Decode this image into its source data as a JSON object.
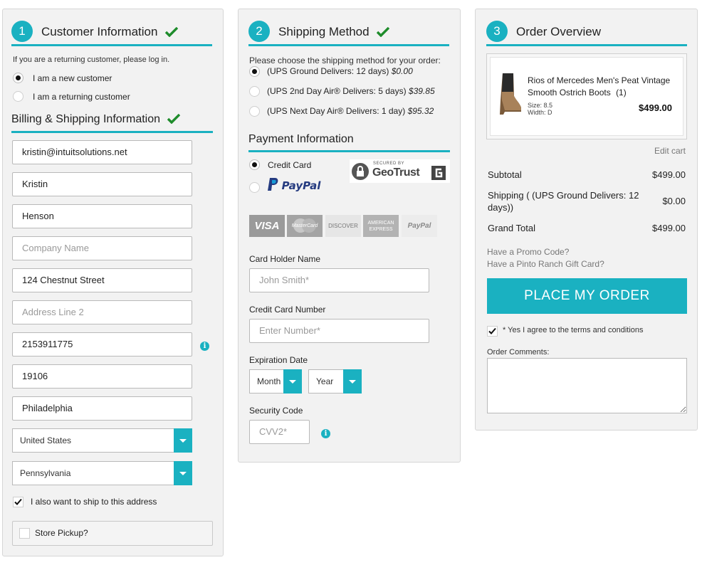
{
  "customer": {
    "step": "1",
    "title": "Customer Information",
    "returning_prompt": "If you are a returning customer, please log in.",
    "options": [
      "I am a new customer",
      "I am a returning customer"
    ],
    "billing_title": "Billing & Shipping Information",
    "fields": {
      "email": "kristin@intuitsolutions.net",
      "first_name": "Kristin",
      "last_name": "Henson",
      "company_placeholder": "Company Name",
      "address1": "124 Chestnut Street",
      "address2_placeholder": "Address Line 2",
      "phone": "2153911775",
      "zip": "19106",
      "city": "Philadelphia",
      "country": "United States",
      "state": "Pennsylvania"
    },
    "ship_to_label": "I also want to ship to this address",
    "store_pickup_label": "Store Pickup?"
  },
  "shipping": {
    "step": "2",
    "title": "Shipping Method",
    "prompt": "Please choose the shipping method for your order:",
    "methods": [
      {
        "label": "(UPS Ground Delivers: 12 days)",
        "price": "$0.00"
      },
      {
        "label": "(UPS 2nd Day Air® Delivers: 5 days)",
        "price": "$39.85"
      },
      {
        "label": "(UPS Next Day Air® Delivers: 1 day)",
        "price": "$95.32"
      }
    ]
  },
  "payment": {
    "title": "Payment Information",
    "credit_card_label": "Credit Card",
    "paypal_label": "PayPal",
    "geotrust_top": "SECURED BY",
    "geotrust_name": "GeoTrust",
    "card_logos": [
      "VISA",
      "MasterCard",
      "DISCOVER",
      "AMERICAN EXPRESS",
      "PayPal"
    ],
    "card_holder_label": "Card Holder Name",
    "card_holder_placeholder": "John Smith*",
    "card_number_label": "Credit Card Number",
    "card_number_placeholder": "Enter Number*",
    "expiration_label": "Expiration Date",
    "month": "Month",
    "year": "Year",
    "security_label": "Security Code",
    "security_placeholder": "CVV2*"
  },
  "overview": {
    "step": "3",
    "title": "Order Overview",
    "product": {
      "name": "Rios of Mercedes Men's Peat Vintage Smooth Ostrich Boots",
      "qty": "(1)",
      "size": "Size: 8.5",
      "width": "Width: D",
      "price": "$499.00"
    },
    "edit_cart": "Edit cart",
    "subtotal_label": "Subtotal",
    "subtotal": "$499.00",
    "shipping_label": "Shipping ( (UPS Ground Delivers: 12 days))",
    "shipping": "$0.00",
    "grand_total_label": "Grand Total",
    "grand_total": "$499.00",
    "promo_link": "Have a Promo Code?",
    "gift_card_link": "Have a Pinto Ranch Gift Card?",
    "place_order": "PLACE MY ORDER",
    "terms_label": "* Yes I agree to the terms and conditions",
    "comments_label": "Order Comments:"
  },
  "colors": {
    "accent": "#1ab1c1",
    "check": "#1e8c2b"
  }
}
